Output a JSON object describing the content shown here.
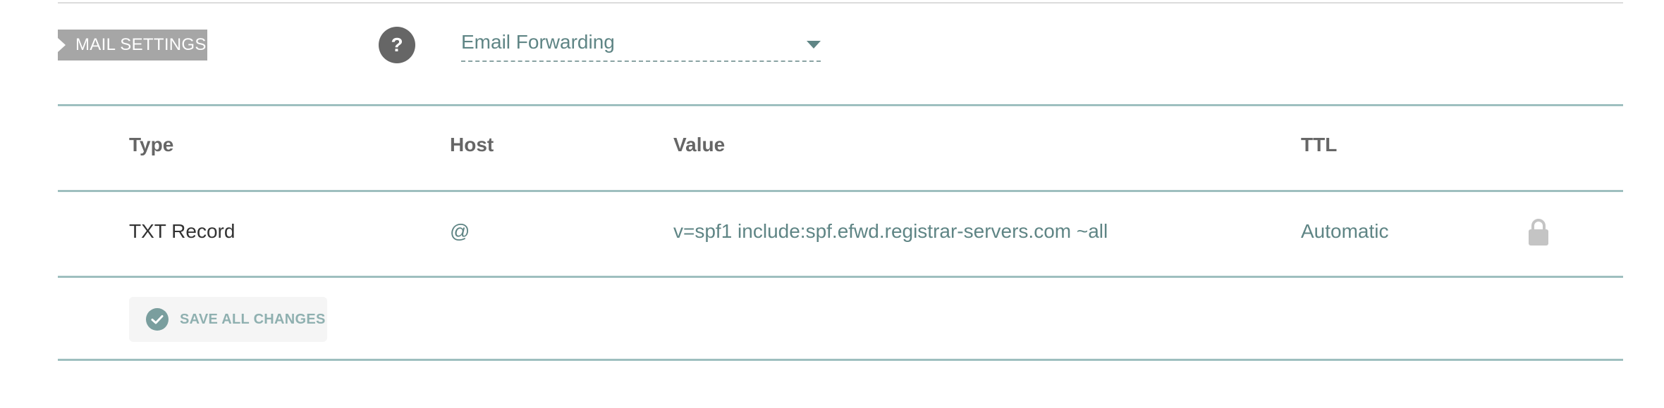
{
  "section": {
    "tag_label": "MAIL SETTINGS",
    "help_label": "?",
    "mail_select_value": "Email Forwarding"
  },
  "table": {
    "columns": [
      "Type",
      "Host",
      "Value",
      "TTL"
    ],
    "rows": [
      {
        "type": "TXT Record",
        "host": "@",
        "value": "v=spf1 include:spf.efwd.registrar-servers.com ~all",
        "ttl": "Automatic",
        "locked": true,
        "lock_icon": "lock-icon"
      }
    ]
  },
  "actions": {
    "save_label": "SAVE ALL CHANGES",
    "save_icon": "check-circle-icon"
  },
  "colors": {
    "accent_teal": "#5f8585",
    "rule_teal": "#9ebfbf",
    "tag_gray": "#a6a6a6",
    "help_gray": "#666666"
  }
}
